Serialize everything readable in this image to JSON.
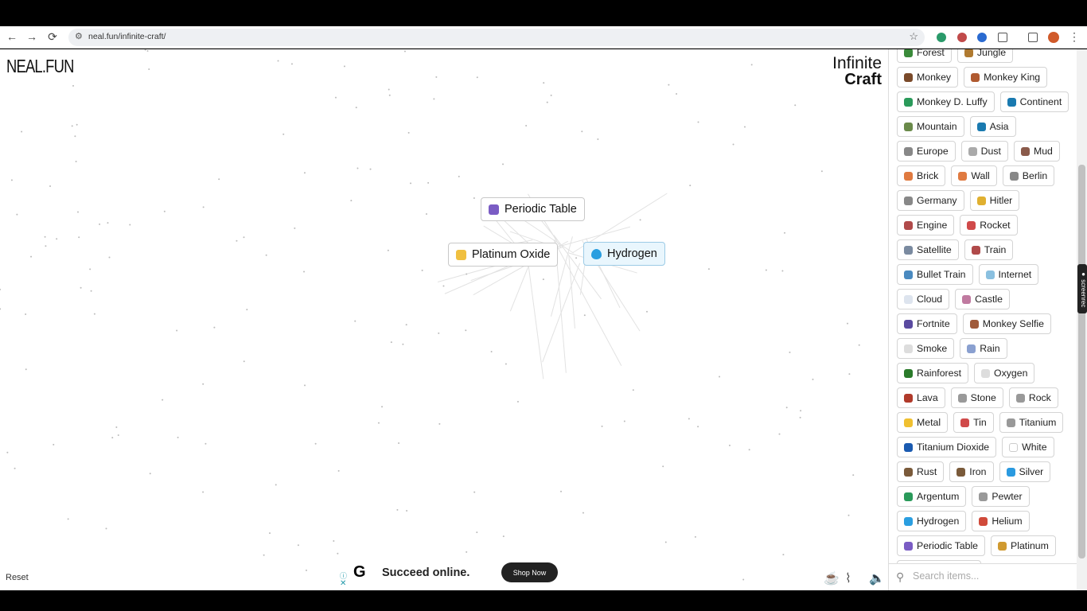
{
  "browser": {
    "url": "neal.fun/infinite-craft/",
    "back": "←",
    "forward": "→",
    "reload": "⟳",
    "star": "☆"
  },
  "page": {
    "logo": "NEAL.FUN",
    "title_line1": "Infinite",
    "title_line2": "Craft",
    "reset": "Reset"
  },
  "canvas_items": [
    {
      "label": "Periodic Table",
      "color": "#7a5cc4",
      "highlighted": false
    },
    {
      "label": "Platinum Oxide",
      "color": "#f0c040",
      "highlighted": false
    },
    {
      "label": "Hydrogen",
      "color": "#2a9ee0",
      "highlighted": true
    }
  ],
  "ad": {
    "headline": "Succeed online.",
    "button": "Shop Now",
    "logo": "G"
  },
  "sidebar": {
    "search_placeholder": "Search items...",
    "items": [
      {
        "label": "Forest",
        "color": "#3a8a3a"
      },
      {
        "label": "Jungle",
        "color": "#b07a30"
      },
      {
        "label": "Monkey",
        "color": "#7a4a2a"
      },
      {
        "label": "Monkey King",
        "color": "#b05a30"
      },
      {
        "label": "Monkey D. Luffy",
        "color": "#2a9a5a"
      },
      {
        "label": "Continent",
        "color": "#1a7ab0"
      },
      {
        "label": "Mountain",
        "color": "#6a8a4a"
      },
      {
        "label": "Asia",
        "color": "#1a7ab0"
      },
      {
        "label": "Europe",
        "color": "#888888"
      },
      {
        "label": "Dust",
        "color": "#aaaaaa"
      },
      {
        "label": "Mud",
        "color": "#8a5a4a"
      },
      {
        "label": "Brick",
        "color": "#e07a40"
      },
      {
        "label": "Wall",
        "color": "#e07a40"
      },
      {
        "label": "Berlin",
        "color": "#888888"
      },
      {
        "label": "Germany",
        "color": "#888888"
      },
      {
        "label": "Hitler",
        "color": "#e0b030"
      },
      {
        "label": "Engine",
        "color": "#b04a4a"
      },
      {
        "label": "Rocket",
        "color": "#d04a4a"
      },
      {
        "label": "Satellite",
        "color": "#7a8aa0"
      },
      {
        "label": "Train",
        "color": "#b04a4a"
      },
      {
        "label": "Bullet Train",
        "color": "#4a8ac0"
      },
      {
        "label": "Internet",
        "color": "#8ac0e0"
      },
      {
        "label": "Cloud",
        "color": "#dde4ee"
      },
      {
        "label": "Castle",
        "color": "#c07aa0"
      },
      {
        "label": "Fortnite",
        "color": "#5a4aa0"
      },
      {
        "label": "Monkey Selfie",
        "color": "#a05a3a"
      },
      {
        "label": "Smoke",
        "color": "#dddddd"
      },
      {
        "label": "Rain",
        "color": "#8aa0d0"
      },
      {
        "label": "Rainforest",
        "color": "#2a7a2a"
      },
      {
        "label": "Oxygen",
        "color": "#dddddd"
      },
      {
        "label": "Lava",
        "color": "#b03a2a"
      },
      {
        "label": "Stone",
        "color": "#999999"
      },
      {
        "label": "Rock",
        "color": "#999999"
      },
      {
        "label": "Metal",
        "color": "#f0c030"
      },
      {
        "label": "Tin",
        "color": "#d04a4a"
      },
      {
        "label": "Titanium",
        "color": "#999999"
      },
      {
        "label": "Titanium Dioxide",
        "color": "#1a5ab0"
      },
      {
        "label": "White",
        "color": "#ffffff"
      },
      {
        "label": "Rust",
        "color": "#7a5a3a"
      },
      {
        "label": "Iron",
        "color": "#7a5a3a"
      },
      {
        "label": "Silver",
        "color": "#2a9ae0"
      },
      {
        "label": "Argentum",
        "color": "#2a9a5a"
      },
      {
        "label": "Pewter",
        "color": "#999999"
      },
      {
        "label": "Hydrogen",
        "color": "#2a9ee0"
      },
      {
        "label": "Helium",
        "color": "#d04a3a"
      },
      {
        "label": "Periodic Table",
        "color": "#7a5cc4"
      },
      {
        "label": "Platinum",
        "color": "#d09a30"
      },
      {
        "label": "",
        "color": "#ffffff"
      }
    ]
  }
}
